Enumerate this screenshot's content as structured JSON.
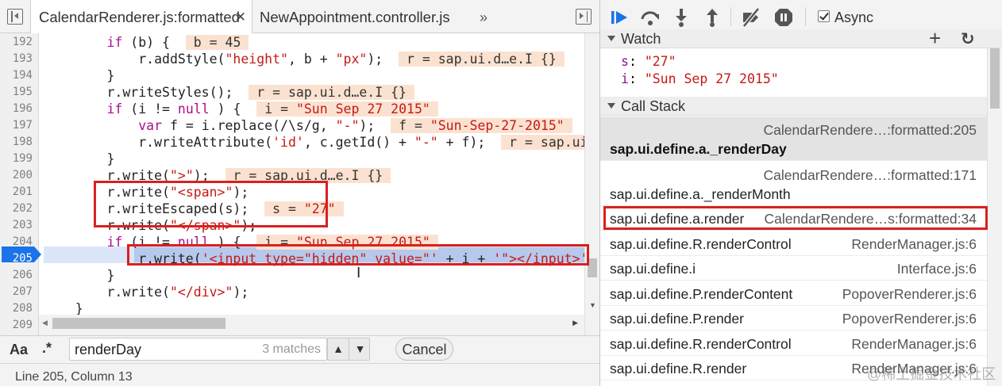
{
  "tabs": {
    "active": "CalendarRenderer.js:formatted",
    "close_glyph": "✕",
    "second": "NewAppointment.controller.js",
    "more": "»"
  },
  "editor": {
    "lines": [
      {
        "n": "192",
        "parts": [
          {
            "t": "        "
          },
          {
            "t": "if",
            "c": "kw"
          },
          {
            "t": " (b) {  "
          },
          {
            "t": " b = ",
            "c": "inl"
          },
          {
            "t": "45 ",
            "c": "inl num"
          }
        ]
      },
      {
        "n": "193",
        "parts": [
          {
            "t": "            r.addStyle("
          },
          {
            "t": "\"height\"",
            "c": "str"
          },
          {
            "t": ", b + "
          },
          {
            "t": "\"px\"",
            "c": "str"
          },
          {
            "t": ");  "
          },
          {
            "t": " r = sap.ui.d…e.I {} ",
            "c": "inl"
          }
        ]
      },
      {
        "n": "194",
        "parts": [
          {
            "t": "        }"
          }
        ]
      },
      {
        "n": "195",
        "parts": [
          {
            "t": "        r.writeStyles();  "
          },
          {
            "t": " r = sap.ui.d…e.I {} ",
            "c": "inl"
          }
        ]
      },
      {
        "n": "196",
        "parts": [
          {
            "t": "        "
          },
          {
            "t": "if",
            "c": "kw"
          },
          {
            "t": " (i != "
          },
          {
            "t": "null",
            "c": "kw"
          },
          {
            "t": " ) {  "
          },
          {
            "t": " i = ",
            "c": "inl"
          },
          {
            "t": "\"Sun Sep 27 2015\" ",
            "c": "inl str"
          }
        ]
      },
      {
        "n": "197",
        "parts": [
          {
            "t": "            "
          },
          {
            "t": "var",
            "c": "kw"
          },
          {
            "t": " f = i.replace(/\\s/g, "
          },
          {
            "t": "\"-\"",
            "c": "str"
          },
          {
            "t": ");  "
          },
          {
            "t": " f = ",
            "c": "inl"
          },
          {
            "t": "\"Sun-Sep-27-2015\" ",
            "c": "inl str"
          }
        ]
      },
      {
        "n": "198",
        "parts": [
          {
            "t": "            r.writeAttribute("
          },
          {
            "t": "'id'",
            "c": "str"
          },
          {
            "t": ", c.getId() + "
          },
          {
            "t": "\"-\"",
            "c": "str"
          },
          {
            "t": " + f);  "
          },
          {
            "t": " r = sap.ui.d…e.I {} ",
            "c": "inl"
          }
        ]
      },
      {
        "n": "199",
        "parts": [
          {
            "t": "        }"
          }
        ]
      },
      {
        "n": "200",
        "parts": [
          {
            "t": "        r.write("
          },
          {
            "t": "\">\"",
            "c": "str"
          },
          {
            "t": ");  "
          },
          {
            "t": " r = sap.ui.d…e.I {} ",
            "c": "inl"
          }
        ]
      },
      {
        "n": "201",
        "parts": [
          {
            "t": "        r.write("
          },
          {
            "t": "\"<span>\"",
            "c": "str"
          },
          {
            "t": ");"
          }
        ]
      },
      {
        "n": "202",
        "parts": [
          {
            "t": "        r.writeEscaped(s);  "
          },
          {
            "t": " s = ",
            "c": "inl"
          },
          {
            "t": "\"27\" ",
            "c": "inl str"
          }
        ]
      },
      {
        "n": "203",
        "parts": [
          {
            "t": "        r.write("
          },
          {
            "t": "\"</span>\"",
            "c": "str"
          },
          {
            "t": ");"
          }
        ]
      },
      {
        "n": "204",
        "parts": [
          {
            "t": "        "
          },
          {
            "t": "if",
            "c": "kw"
          },
          {
            "t": " (i != "
          },
          {
            "t": "null",
            "c": "kw"
          },
          {
            "t": " ) {  "
          },
          {
            "t": " i = ",
            "c": "inl"
          },
          {
            "t": "\"Sun Sep 27 2015\" ",
            "c": "inl str"
          }
        ]
      },
      {
        "n": "205",
        "active": true,
        "parts": [
          {
            "t": "            r.write("
          },
          {
            "t": "'<input type=\"hidden\" value=\"'",
            "c": "str"
          },
          {
            "t": " + i + "
          },
          {
            "t": "'\"></input>'",
            "c": "str"
          },
          {
            "t": ");"
          }
        ]
      },
      {
        "n": "206",
        "parts": [
          {
            "t": "        }"
          }
        ]
      },
      {
        "n": "207",
        "parts": [
          {
            "t": "        r.write("
          },
          {
            "t": "\"</div>\"",
            "c": "str"
          },
          {
            "t": ");"
          }
        ]
      },
      {
        "n": "208",
        "parts": [
          {
            "t": "    }"
          }
        ]
      },
      {
        "n": "209",
        "parts": [
          {
            "t": ""
          }
        ]
      }
    ]
  },
  "search": {
    "case_label": "Aa",
    "regex_label": ".*",
    "value": "renderDay",
    "matches": "3 matches",
    "prev_glyph": "▲",
    "next_glyph": "▼",
    "cancel_label": "Cancel"
  },
  "status": {
    "position": "Line 205, Column 13"
  },
  "debugger": {
    "async_label": "Async",
    "async_checked": true
  },
  "watch": {
    "title": "Watch",
    "add_glyph": "+",
    "refresh_glyph": "↻",
    "items": [
      {
        "name": "s",
        "value": "\"27\""
      },
      {
        "name": "i",
        "value": "\"Sun Sep 27 2015\""
      }
    ]
  },
  "call_stack": {
    "title": "Call Stack",
    "frames": [
      {
        "fn": "sap.ui.define.a._renderDay",
        "loc": "CalendarRendere…:formatted:205",
        "selected": true,
        "two_line": true
      },
      {
        "fn": "sap.ui.define.a._renderMonth",
        "loc": "CalendarRendere…:formatted:171",
        "two_line": true
      },
      {
        "fn": "sap.ui.define.a.render",
        "loc": "CalendarRendere…s:formatted:34"
      },
      {
        "fn": "sap.ui.define.R.renderControl",
        "loc": "RenderManager.js:6"
      },
      {
        "fn": "sap.ui.define.i",
        "loc": "Interface.js:6"
      },
      {
        "fn": "sap.ui.define.P.renderContent",
        "loc": "PopoverRenderer.js:6"
      },
      {
        "fn": "sap.ui.define.P.render",
        "loc": "PopoverRenderer.js:6"
      },
      {
        "fn": "sap.ui.define.R.renderControl",
        "loc": "RenderManager.js:6"
      },
      {
        "fn": "sap.ui.define.R.render",
        "loc": "RenderManager.js:6"
      }
    ]
  },
  "watermark": "@稀土掘金技术社区",
  "colors": {
    "highlight_red": "#d92020",
    "exec_line": "#dbe6f8",
    "gutter_active": "#1a73e8",
    "debug_blue": "#1a73e8"
  }
}
